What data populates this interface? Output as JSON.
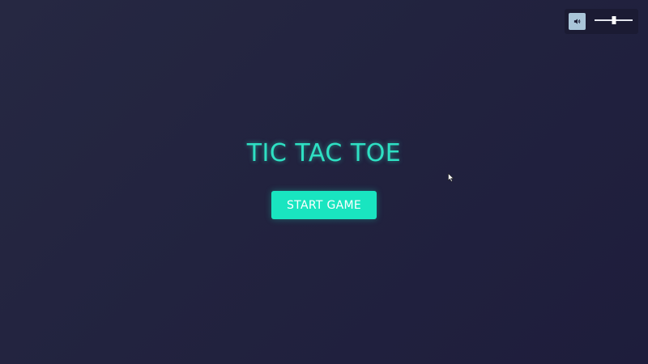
{
  "title": "TIC TAC TOE",
  "start_button_label": "START GAME",
  "volume": {
    "icon": "speaker-icon",
    "level_percent": 50
  },
  "colors": {
    "accent": "#19e5c0",
    "title": "#2ee0c3",
    "background": "#22233f",
    "volume_button": "#a9c5d8"
  }
}
